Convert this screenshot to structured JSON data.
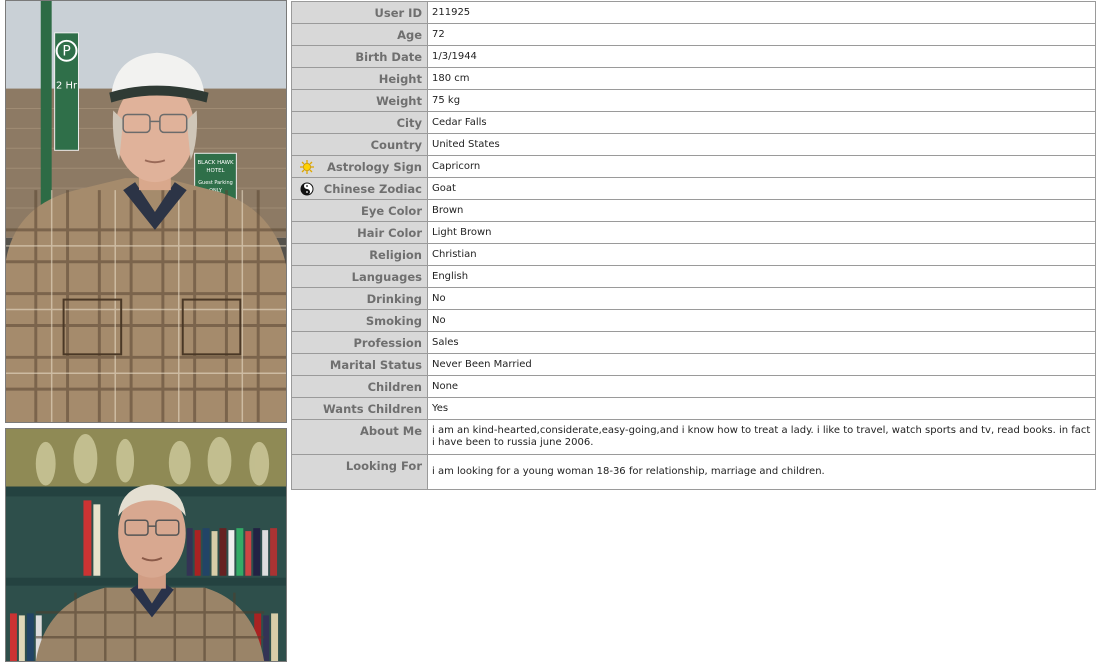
{
  "profile": {
    "rows": [
      {
        "label": "User ID",
        "value": "211925"
      },
      {
        "label": "Age",
        "value": "72"
      },
      {
        "label": "Birth Date",
        "value": "1/3/1944"
      },
      {
        "label": "Height",
        "value": "180 cm"
      },
      {
        "label": "Weight",
        "value": "75 kg"
      },
      {
        "label": "City",
        "value": "Cedar Falls"
      },
      {
        "label": "Country",
        "value": "United States"
      },
      {
        "label": "Astrology Sign",
        "value": "Capricorn",
        "icon": "sun-icon"
      },
      {
        "label": "Chinese Zodiac",
        "value": "Goat",
        "icon": "yin-yang-icon"
      },
      {
        "label": "Eye Color",
        "value": "Brown"
      },
      {
        "label": "Hair Color",
        "value": "Light Brown"
      },
      {
        "label": "Religion",
        "value": "Christian"
      },
      {
        "label": "Languages",
        "value": "English"
      },
      {
        "label": "Drinking",
        "value": "No"
      },
      {
        "label": "Smoking",
        "value": "No"
      },
      {
        "label": "Profession",
        "value": "Sales"
      },
      {
        "label": "Marital Status",
        "value": "Never Been Married"
      },
      {
        "label": "Children",
        "value": "None"
      },
      {
        "label": "Wants Children",
        "value": "Yes"
      },
      {
        "label": "About Me",
        "value": "i am an kind-hearted,considerate,easy-going,and i know how to treat a lady. i like to travel, watch sports and tv, read books. in fact i have been to russia june 2006."
      },
      {
        "label": "Looking For",
        "value": "i am looking for a young woman 18-36 for relationship, marriage and children."
      }
    ]
  },
  "photos": {
    "main_sign_text": "P",
    "main_sign_sub": "2 Hr",
    "hotel_sign": [
      "BLACK HAWK",
      "HOTEL",
      "Guest Parking",
      "ONLY"
    ]
  },
  "colors": {
    "label_bg": "#d8d8d8",
    "label_text": "#6f6f6f",
    "border": "#9a9a9a"
  }
}
